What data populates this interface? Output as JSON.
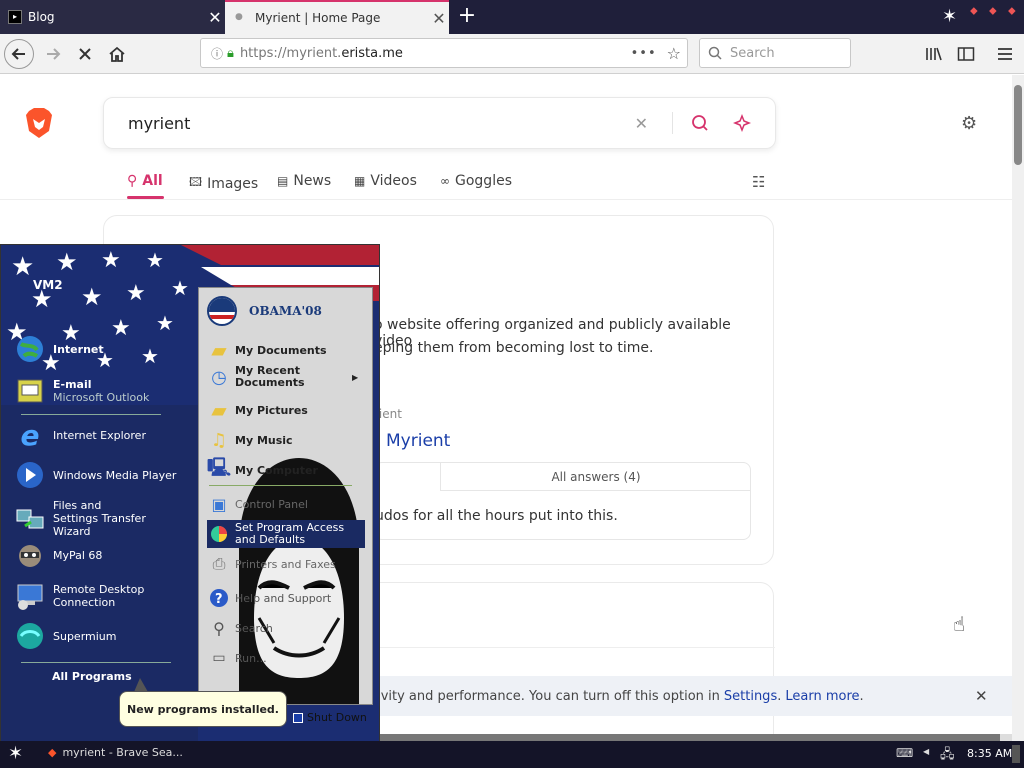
{
  "browser": {
    "tabs": [
      {
        "title": "Blog",
        "active": false
      },
      {
        "title": "Myrient | Home Page",
        "active": true
      }
    ],
    "url_prefix": "https://myrient.",
    "url_domain": "erista.me",
    "search_placeholder": "Search",
    "url_dots": "•••"
  },
  "serp": {
    "query": "myrient",
    "tabs": [
      "All",
      "Images",
      "News",
      "Videos",
      "Goggles"
    ],
    "snippet_line1": "o website offering organized and publicly available video",
    "snippet_line2": "eping them from becoming lost to time.",
    "source_label": "rient",
    "result_title": "Myrient",
    "answers_tab": "All answers (4)",
    "answer_text": "udos for all the hours put into this.",
    "privacy_prefix": "tivity and performance. You can turn off this option in ",
    "privacy_settings": "Settings",
    "privacy_sep": ". ",
    "privacy_learn": "Learn more",
    "privacy_end": "."
  },
  "startmenu": {
    "username": "VM2",
    "pinned": [
      {
        "label": "Internet",
        "sub": ""
      },
      {
        "label": "E-mail",
        "sub": "Microsoft Outlook"
      }
    ],
    "recent": [
      {
        "label": "Internet Explorer"
      },
      {
        "label": "Windows Media Player"
      },
      {
        "label": "Files and Settings Transfer Wizard"
      },
      {
        "label": "MyPal 68"
      },
      {
        "label": "Remote Desktop Connection"
      },
      {
        "label": "Supermium"
      }
    ],
    "all_programs": "All Programs",
    "right_logo": "OBAMA'08",
    "right_items": [
      "My Documents",
      "My Recent Documents",
      "My Pictures",
      "My Music",
      "My Computer",
      "Control Panel",
      "Set Program Access and Defaults",
      "Printers and Faxes",
      "Help and Support",
      "Search",
      "Run..."
    ],
    "shutdown": "Shut Down"
  },
  "balloon": "New programs installed.",
  "taskbar": {
    "task_label": "myrient - Brave Sea...",
    "clock": "8:35 AM"
  },
  "colors": {
    "brave_orange": "#fb542b",
    "link_blue": "#1a3ea8",
    "accent_pink": "#d6336c"
  }
}
